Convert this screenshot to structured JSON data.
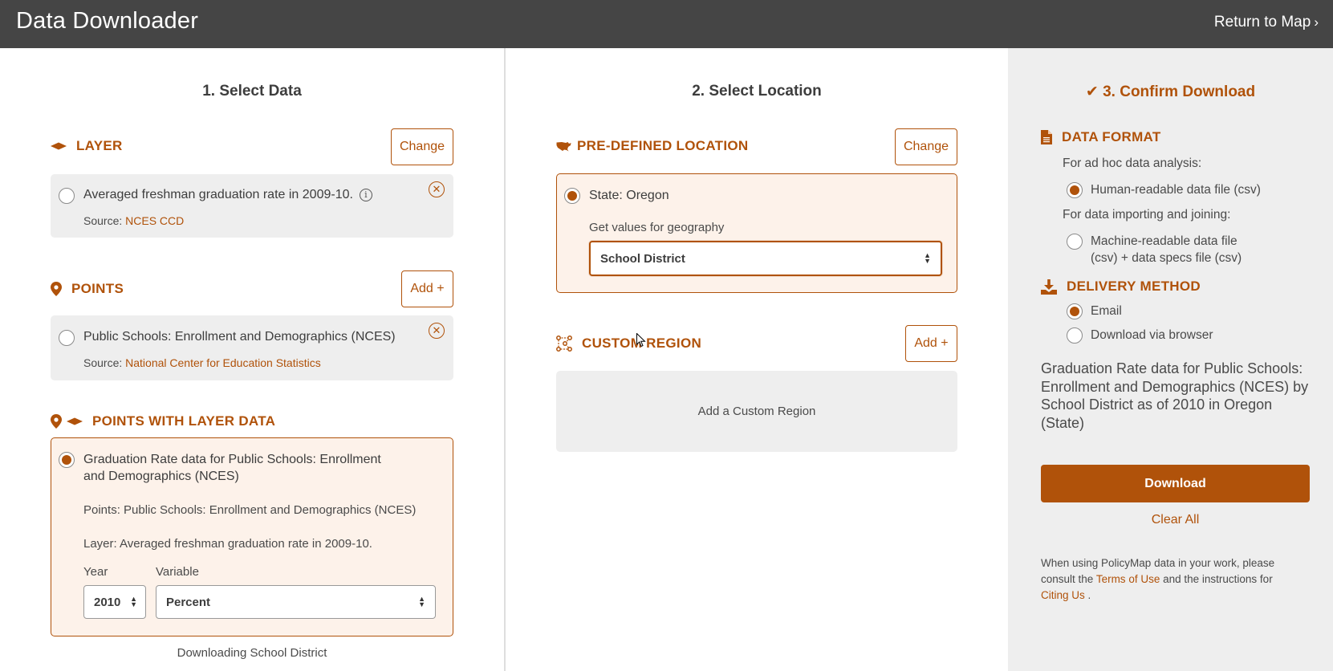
{
  "header": {
    "title": "Data Downloader",
    "return_label": "Return to Map",
    "return_chevron": "›"
  },
  "select_data": {
    "title": "1. Select Data",
    "layer": {
      "heading": "LAYER",
      "icon": "layer-icon",
      "button_label": "Change",
      "item": {
        "name": "Averaged freshman graduation rate in 2009-10.",
        "source_prefix": "Source:",
        "source_link": "NCES CCD",
        "selected": false
      }
    },
    "points": {
      "heading": "POINTS",
      "icon": "map-pin-icon",
      "button_label": "Add +",
      "item": {
        "name": "Public Schools: Enrollment and Demographics (NCES)",
        "source_prefix": "Source:",
        "source_link": "National Center for Education Statistics",
        "selected": false
      }
    },
    "points_with_layer": {
      "heading": "POINTS WITH LAYER DATA",
      "icons": [
        "map-pin-icon",
        "layer-icon"
      ],
      "item": {
        "title_line1": "Graduation Rate data for Public Schools: Enrollment",
        "title_line2": "and Demographics (NCES)",
        "points_line": "Points: Public Schools: Enrollment and Demographics (NCES)",
        "layer_line": "Layer: Averaged freshman graduation rate in 2009-10.",
        "selected": true,
        "year_label": "Year",
        "year_value": "2010",
        "variable_label": "Variable",
        "variable_value": "Percent"
      }
    },
    "footer_note": "Downloading School District"
  },
  "select_location": {
    "title": "2. Select Location",
    "predefined": {
      "heading": "PRE-DEFINED LOCATION",
      "icon": "usa-map-icon",
      "button_label": "Change",
      "item": {
        "name": "State: Oregon",
        "selected": true,
        "geography_label": "Get values for geography",
        "geography_value": "School District"
      }
    },
    "custom": {
      "heading": "CUSTOM REGION",
      "icon": "polygon-region-icon",
      "button_label": "Add +",
      "placeholder": "Add a Custom Region"
    }
  },
  "confirm": {
    "title": "3. Confirm Download",
    "title_icon": "checkmark-icon",
    "data_format": {
      "heading": "DATA FORMAT",
      "icon": "document-icon",
      "group1_label": "For ad hoc data analysis:",
      "option1": {
        "label": "Human-readable data file (csv)",
        "selected": true
      },
      "group2_label": "For data importing and joining:",
      "option2": {
        "label_line1": "Machine-readable data file",
        "label_line2": "(csv) + data specs file (csv)",
        "selected": false
      }
    },
    "delivery": {
      "heading": "DELIVERY METHOD",
      "icon": "download-tray-icon",
      "options": [
        {
          "label": "Email",
          "selected": true
        },
        {
          "label": "Download via browser",
          "selected": false
        }
      ]
    },
    "summary": "Graduation Rate data for Public Schools: Enrollment and Demographics (NCES) by School District as of 2010 in Oregon (State)",
    "download_label": "Download",
    "clear_label": "Clear All",
    "footer": {
      "text1": "When using PolicyMap data in your work, please consult the",
      "link1": "Terms of Use",
      "text2": "and the instructions for",
      "link2": "Citing Us",
      "text3": "."
    }
  },
  "colors": {
    "accent": "#b0520a",
    "header_bg": "#454545",
    "card_bg": "#eeeeee",
    "selected_card_bg": "#fdf2ea"
  }
}
